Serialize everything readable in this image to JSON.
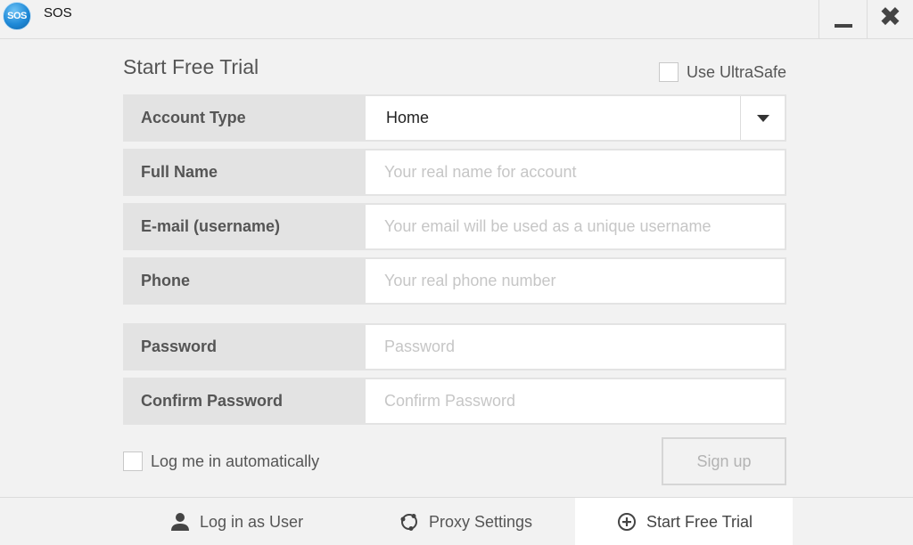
{
  "window": {
    "app_logo_text": "SOS",
    "title": "SOS",
    "minimize_icon": "minimize-icon",
    "close_icon": "close-icon"
  },
  "form": {
    "title": "Start Free Trial",
    "ultrasafe": {
      "label": "Use UltraSafe",
      "checked": false
    },
    "fields": [
      {
        "label": "Account Type",
        "type": "select",
        "value": "Home"
      },
      {
        "label": "Full Name",
        "type": "text",
        "value": "",
        "placeholder": "Your real name for account"
      },
      {
        "label": "E-mail (username)",
        "type": "text",
        "value": "",
        "placeholder": "Your email will be used as a unique username"
      },
      {
        "label": "Phone",
        "type": "text",
        "value": "",
        "placeholder": "Your real phone number"
      },
      {
        "label": "Password",
        "type": "password",
        "value": "",
        "placeholder": "Password"
      },
      {
        "label": "Confirm Password",
        "type": "password",
        "value": "",
        "placeholder": "Confirm Password"
      }
    ],
    "auto_login": {
      "label": "Log me in automatically",
      "checked": false
    },
    "signup_label": "Sign up"
  },
  "bottom_nav": {
    "items": [
      {
        "label": "Log in as User",
        "icon": "user-icon",
        "active": false
      },
      {
        "label": "Proxy Settings",
        "icon": "proxy-icon",
        "active": false
      },
      {
        "label": "Start Free Trial",
        "icon": "plus-circle-icon",
        "active": true
      }
    ]
  }
}
